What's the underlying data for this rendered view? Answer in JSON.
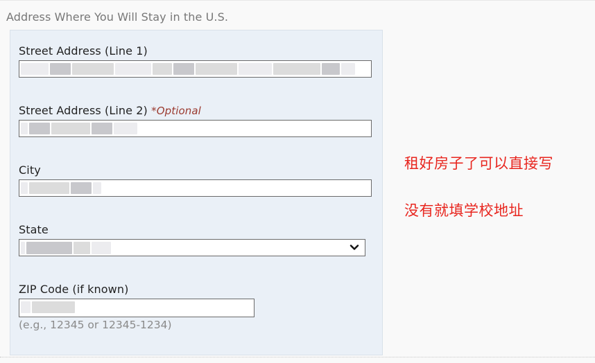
{
  "section": {
    "title": "Address Where You Will Stay in the U.S."
  },
  "form": {
    "street1": {
      "label": "Street Address (Line 1)",
      "value": ""
    },
    "street2": {
      "label": "Street Address (Line 2)",
      "optional": "*Optional",
      "value": ""
    },
    "city": {
      "label": "City",
      "value": ""
    },
    "state": {
      "label": "State",
      "selected": ""
    },
    "zip": {
      "label": "ZIP Code (if known)",
      "value": "",
      "hint": "(e.g., 12345 or 12345-1234)"
    }
  },
  "annotations": {
    "line1": "租好房子了可以直接写",
    "line2": "没有就填学校地址",
    "color": "#e8261f"
  },
  "icons": {
    "state_dropdown": "chevron-down-icon"
  }
}
